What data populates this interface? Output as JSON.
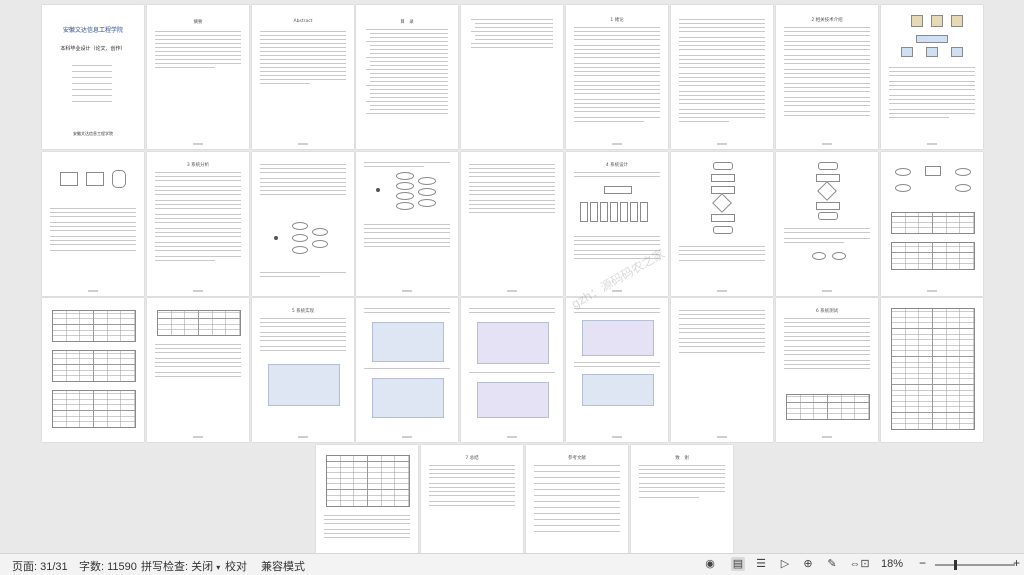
{
  "document": {
    "school_name": "安徽文达信息工程学院",
    "cover_title": "本科毕业设计（论文、创作）",
    "cover_footer": "安徽文达信息工程学院",
    "abstract_cn_title": "摘要",
    "abstract_en_title": "Abstract",
    "toc_title": "目　录",
    "ch1_title": "1 绪论",
    "ch2_title": "2 相关技术介绍",
    "ch3_title": "3 系统分析",
    "ch4_title": "4 系统设计",
    "ch5_title": "5 系统实现",
    "ch6_title": "6 系统测试",
    "conclusion_title": "7 总结",
    "ref_title": "参考文献",
    "thanks_title": "致　谢",
    "watermark": "gzh：源码码农之家"
  },
  "status_bar": {
    "page_label": "页面: 31/31",
    "word_count_label": "字数: 11590",
    "spell_check_label": "拼写检查: 关闭",
    "proofread_label": "校对",
    "compat_label": "兼容模式",
    "zoom_label": "18%",
    "zoom_minus": "−",
    "zoom_plus": "+",
    "zoom_level": 0.18,
    "icons": [
      "eye-icon",
      "page-view-icon",
      "outline-icon",
      "play-icon",
      "globe-icon",
      "pen-icon",
      "fit-width-icon",
      "fit-page-icon"
    ]
  }
}
